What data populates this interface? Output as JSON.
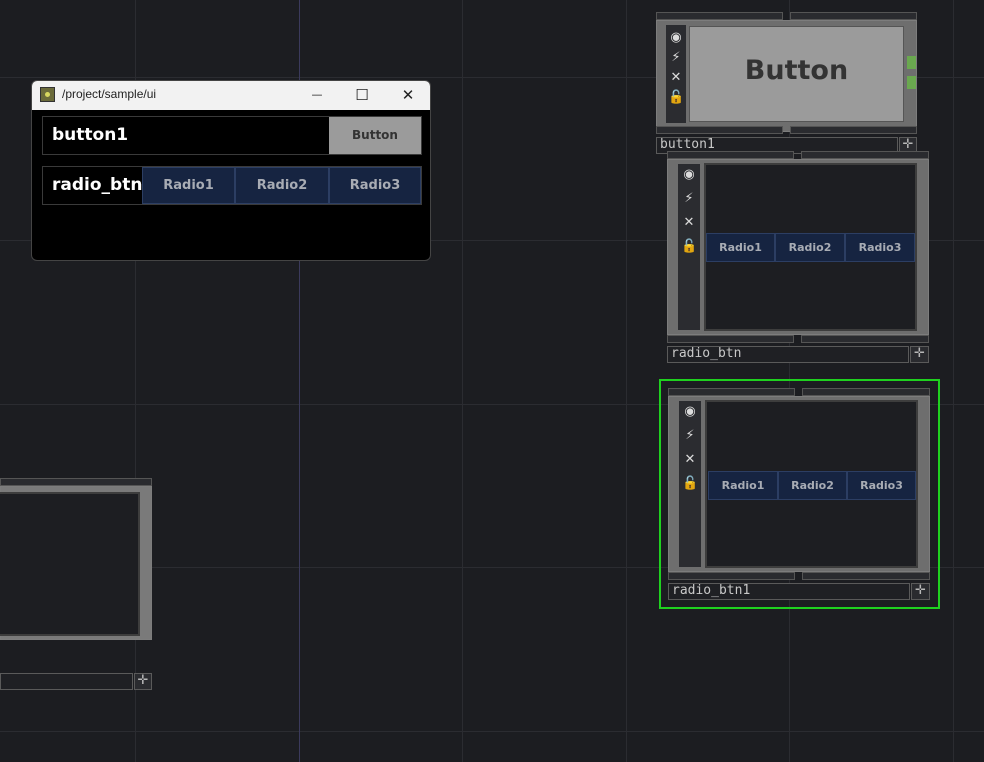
{
  "window": {
    "path": "/project/sample/ui",
    "button_row_label": "button1",
    "button_label": "Button",
    "radio_row_label": "radio_btn",
    "radios": [
      "Radio1",
      "Radio2",
      "Radio3"
    ]
  },
  "window_controls": {
    "minimize": "—",
    "maximize": "☐",
    "close": "✕"
  },
  "nodes": {
    "button1": {
      "name": "button1",
      "button_label": "Button"
    },
    "radio_btn": {
      "name": "radio_btn",
      "radios": [
        "Radio1",
        "Radio2",
        "Radio3"
      ]
    },
    "radio_btn1": {
      "name": "radio_btn1",
      "radios": [
        "Radio1",
        "Radio2",
        "Radio3"
      ]
    },
    "partial_node": {
      "name": ""
    }
  },
  "node_side_icons": [
    "viewer-icon",
    "bypass-icon",
    "delete-icon",
    "lock-icon"
  ],
  "colors": {
    "selection": "#1fd11f",
    "radio_bg": "#162441",
    "canvas": "#1c1d21"
  }
}
